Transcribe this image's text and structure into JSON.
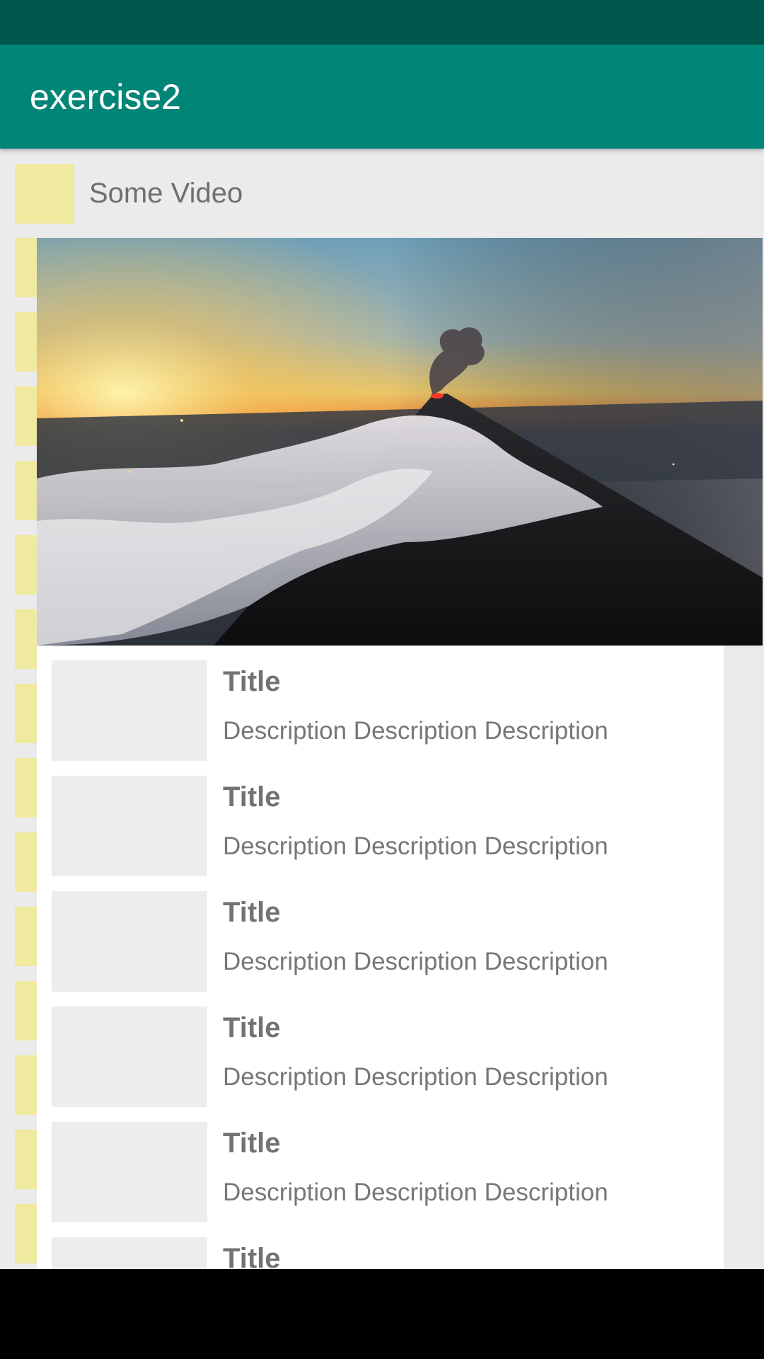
{
  "app_bar": {
    "title": "exercise2"
  },
  "header": {
    "label": "Some Video",
    "thumbnail_color": "#f0e9a0"
  },
  "video": {
    "subject": "volcano-eruption-above-clouds-at-sunset"
  },
  "list": {
    "items": [
      {
        "title": "Title",
        "description": "Description Description Description"
      },
      {
        "title": "Title",
        "description": "Description Description Description"
      },
      {
        "title": "Title",
        "description": "Description Description Description"
      },
      {
        "title": "Title",
        "description": "Description Description Description"
      },
      {
        "title": "Title",
        "description": "Description Description Description"
      },
      {
        "title": "Title",
        "description": ""
      }
    ]
  },
  "colors": {
    "status_bar": "#00574b",
    "app_bar": "#008577",
    "background": "#ebebeb",
    "thumbnail_placeholder": "#ededed",
    "accent_yellow": "#f0e9a0"
  }
}
